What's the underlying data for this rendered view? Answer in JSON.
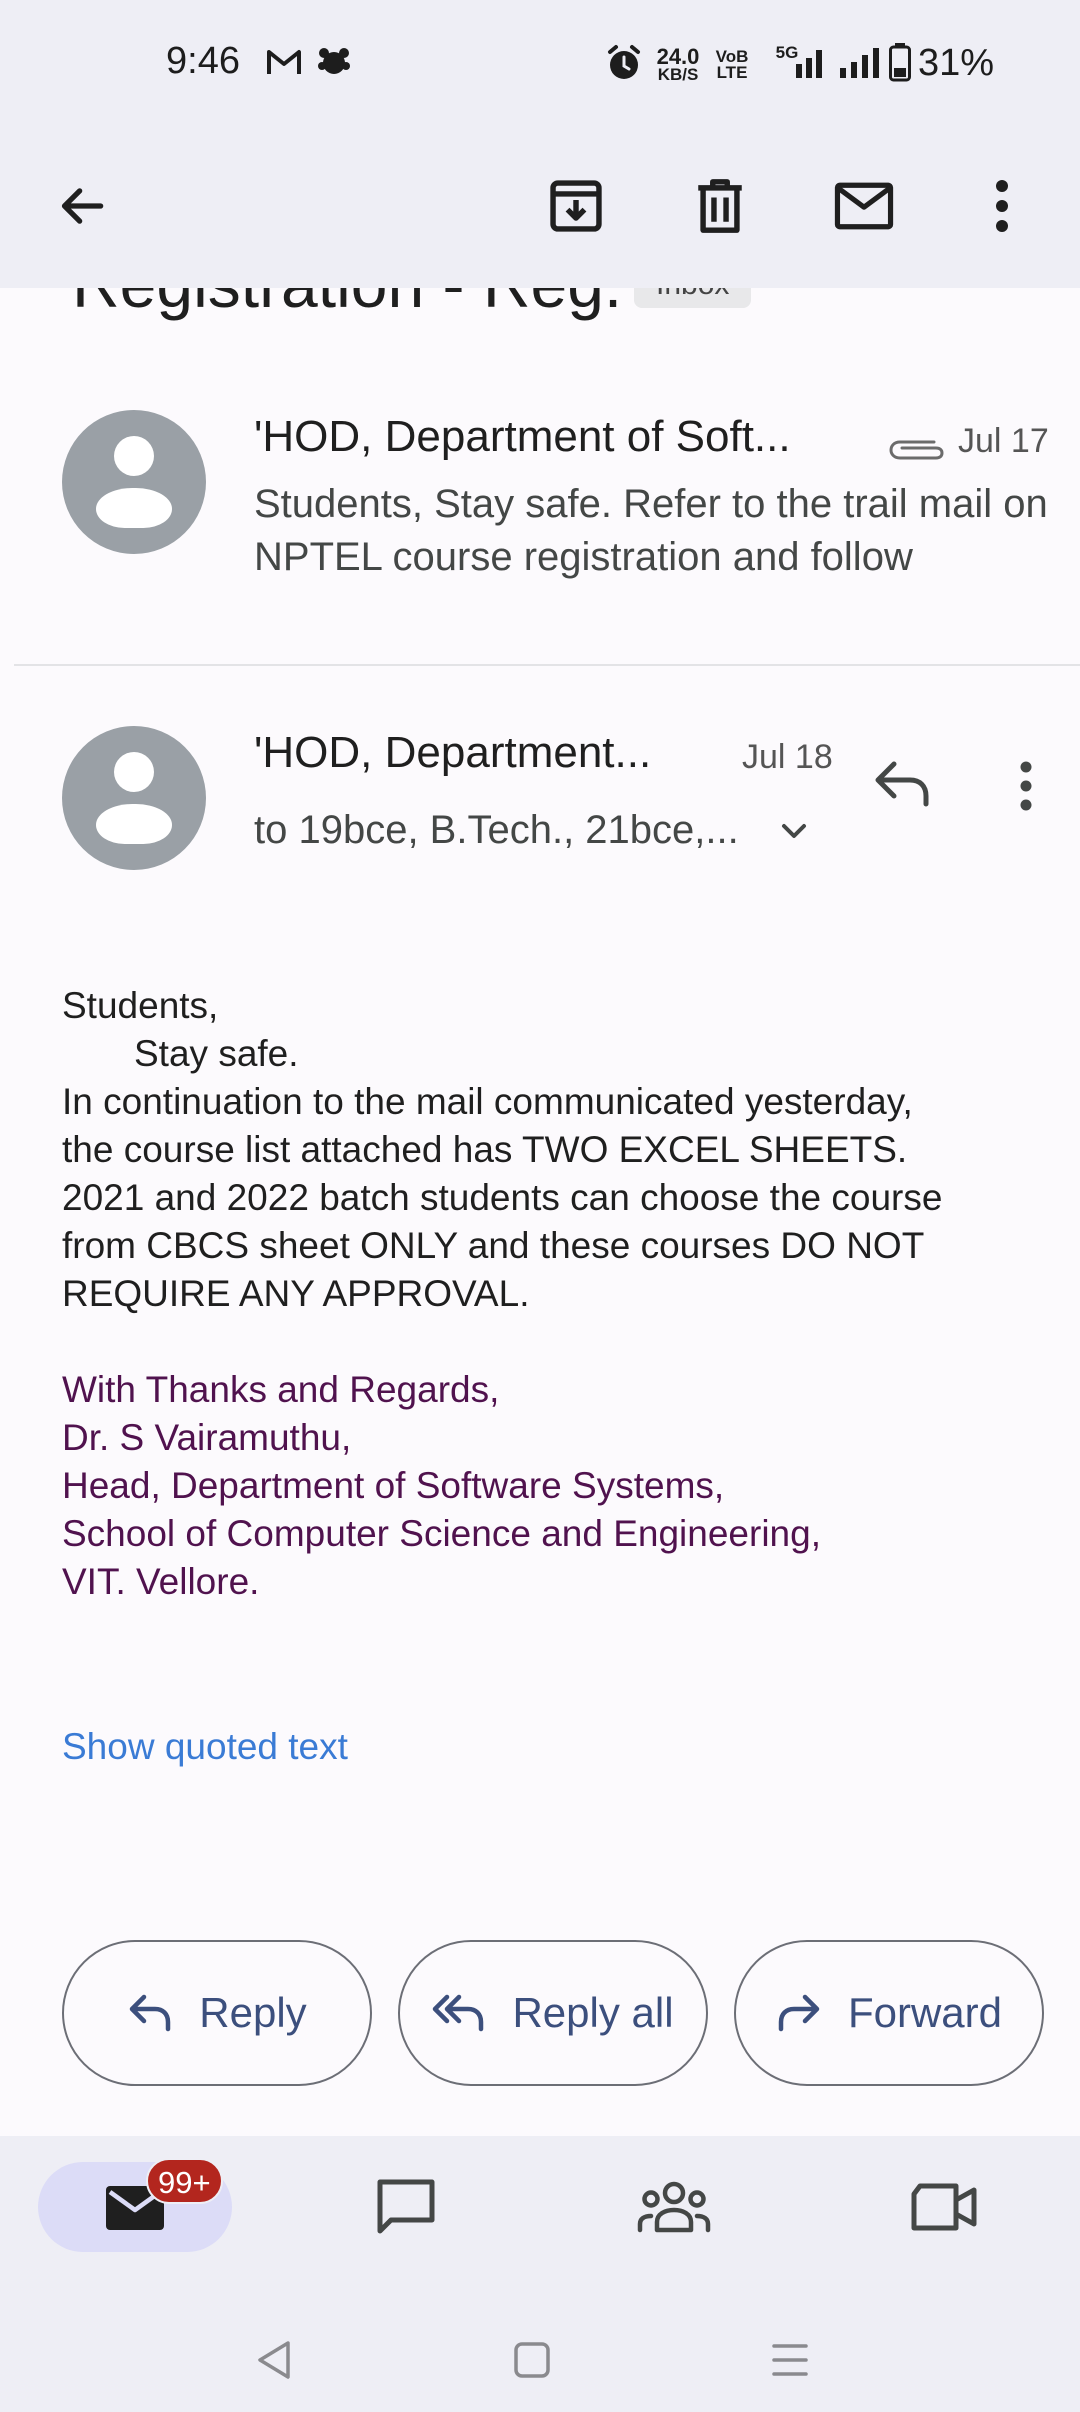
{
  "status_bar": {
    "time": "9:46",
    "net_speed_value": "24.0",
    "net_speed_unit": "KB/S",
    "volte_top": "VoB",
    "volte_bottom": "LTE",
    "network": "5G",
    "battery": "31%"
  },
  "toolbar": {
    "icons": [
      "back-arrow-icon",
      "archive-icon",
      "delete-icon",
      "mark-unread-icon",
      "more-vert-icon"
    ]
  },
  "thread": {
    "subject_partial": "Registration - Reg.",
    "label_chip": "Inbox"
  },
  "message1": {
    "sender": "'HOD, Department of Soft...",
    "date": "Jul 17",
    "snippet": "Students, Stay safe. Refer to the trail mail on NPTEL course registration and follow"
  },
  "message2": {
    "sender": "'HOD, Department...",
    "date": "Jul 18",
    "recipients": "to 19bce, B.Tech., 21bce,...",
    "body": {
      "greeting": "Students,",
      "line2": "Stay safe.",
      "line3": "In continuation to the mail communicated yesterday,",
      "line4": "the course list attached has TWO EXCEL SHEETS.",
      "line5": "2021 and 2022 batch students can choose the course",
      "line6": "from CBCS sheet ONLY and these courses DO NOT",
      "line7": "REQUIRE ANY APPROVAL."
    },
    "signature": {
      "line1": "With Thanks and Regards,",
      "line2": "Dr. S Vairamuthu,",
      "line3": "Head, Department of Software Systems,",
      "line4": "School of Computer Science and Engineering,",
      "line5": "VIT. Vellore."
    },
    "show_quoted_text": "Show quoted text"
  },
  "actions": {
    "reply": "Reply",
    "reply_all": "Reply all",
    "forward": "Forward"
  },
  "bottom_nav": {
    "mail_badge": "99+",
    "items": [
      "mail-icon",
      "chat-icon",
      "spaces-icon",
      "meet-icon"
    ]
  },
  "colors": {
    "bar_background": "#eeeef5",
    "accent_text": "#3c4f7d",
    "link": "#3a7bd5",
    "signature": "#50124e",
    "badge": "#b3261e"
  }
}
